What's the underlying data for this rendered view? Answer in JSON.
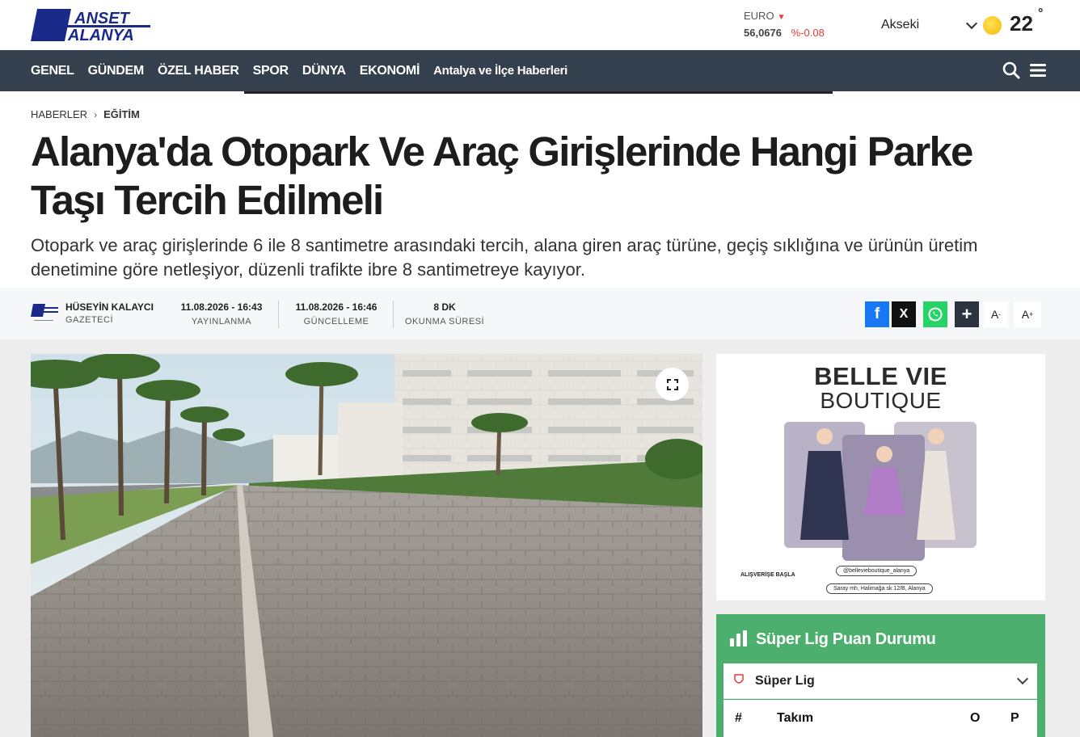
{
  "header": {
    "logo_top": "MANŞET",
    "logo_bottom": "ALANYA",
    "currency": {
      "name": "EURO",
      "value": "56,0676",
      "change": "%-0.08"
    },
    "weather": {
      "city": "Akseki",
      "temp": "22",
      "degree": "°"
    }
  },
  "nav": {
    "items": [
      "GENEL",
      "GÜNDEM",
      "ÖZEL HABER",
      "SPOR",
      "DÜNYA",
      "EKONOMİ",
      "Antalya ve İlçe Haberleri"
    ]
  },
  "breadcrumb": {
    "home": "HABERLER",
    "category": "EĞİTİM"
  },
  "article": {
    "title": "Alanya'da Otopark Ve Araç Girişlerinde Hangi Parke Taşı Tercih Edilmeli",
    "summary": "Otopark ve araç girişlerinde 6 ile 8 santimetre arasındaki tercih, alana giren araç türüne, geçiş sıklığına ve ürünün üretim denetimine göre netleşiyor, düzenli trafikte ibre 8 santimetreye kayıyor."
  },
  "meta": {
    "author_name": "HÜSEYİN KALAYCI",
    "author_role": "GAZETECİ",
    "published": {
      "value": "11.08.2026 - 16:43",
      "label": "YAYINLANMA"
    },
    "updated": {
      "value": "11.08.2026 - 16:46",
      "label": "GÜNCELLEME"
    },
    "reading": {
      "value": "8 DK",
      "label": "OKUNMA SÜRESİ"
    }
  },
  "share": {
    "facebook": "f",
    "x": "X",
    "more": "+",
    "font_small": "A",
    "font_small_sup": "-",
    "font_large": "A",
    "font_large_sup": "+"
  },
  "ad": {
    "title_line1": "BELLE VIE",
    "title_line2": "BOUTIQUE",
    "cta": "ALIŞVERİŞE BAŞLA",
    "instagram": "@bellevieboutique_alanya",
    "address": "Saray mh, Halimağa sk 12/B, Alanya"
  },
  "standings": {
    "title": "Süper Lig Puan Durumu",
    "league": "Süper Lig",
    "columns": {
      "rank": "#",
      "team": "Takım",
      "played": "O",
      "points": "P"
    }
  },
  "colors": {
    "nav_bg": "#35404e",
    "facebook": "#1877f2",
    "x": "#111111",
    "whatsapp": "#25d366",
    "more": "#2c3440",
    "widget": "#4caf6e",
    "accent_red": "#e53935"
  },
  "icons": [
    "search-icon",
    "menu-icon",
    "chevron-down-icon",
    "sun-icon",
    "expand-icon",
    "chart-bar-icon",
    "whatsapp-icon"
  ]
}
